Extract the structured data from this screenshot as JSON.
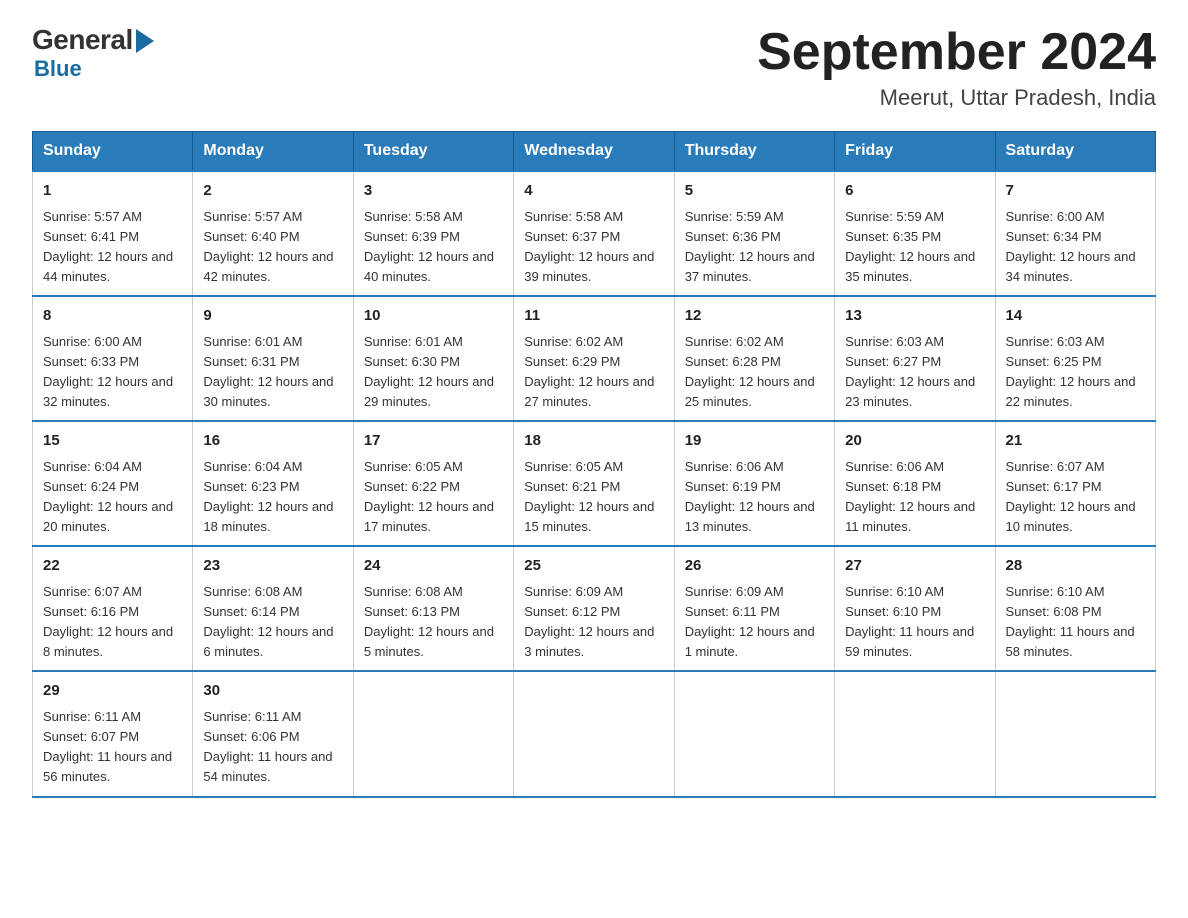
{
  "logo": {
    "general": "General",
    "blue": "Blue"
  },
  "title": {
    "month": "September 2024",
    "location": "Meerut, Uttar Pradesh, India"
  },
  "headers": [
    "Sunday",
    "Monday",
    "Tuesday",
    "Wednesday",
    "Thursday",
    "Friday",
    "Saturday"
  ],
  "weeks": [
    [
      {
        "day": "1",
        "sunrise": "5:57 AM",
        "sunset": "6:41 PM",
        "daylight": "12 hours and 44 minutes."
      },
      {
        "day": "2",
        "sunrise": "5:57 AM",
        "sunset": "6:40 PM",
        "daylight": "12 hours and 42 minutes."
      },
      {
        "day": "3",
        "sunrise": "5:58 AM",
        "sunset": "6:39 PM",
        "daylight": "12 hours and 40 minutes."
      },
      {
        "day": "4",
        "sunrise": "5:58 AM",
        "sunset": "6:37 PM",
        "daylight": "12 hours and 39 minutes."
      },
      {
        "day": "5",
        "sunrise": "5:59 AM",
        "sunset": "6:36 PM",
        "daylight": "12 hours and 37 minutes."
      },
      {
        "day": "6",
        "sunrise": "5:59 AM",
        "sunset": "6:35 PM",
        "daylight": "12 hours and 35 minutes."
      },
      {
        "day": "7",
        "sunrise": "6:00 AM",
        "sunset": "6:34 PM",
        "daylight": "12 hours and 34 minutes."
      }
    ],
    [
      {
        "day": "8",
        "sunrise": "6:00 AM",
        "sunset": "6:33 PM",
        "daylight": "12 hours and 32 minutes."
      },
      {
        "day": "9",
        "sunrise": "6:01 AM",
        "sunset": "6:31 PM",
        "daylight": "12 hours and 30 minutes."
      },
      {
        "day": "10",
        "sunrise": "6:01 AM",
        "sunset": "6:30 PM",
        "daylight": "12 hours and 29 minutes."
      },
      {
        "day": "11",
        "sunrise": "6:02 AM",
        "sunset": "6:29 PM",
        "daylight": "12 hours and 27 minutes."
      },
      {
        "day": "12",
        "sunrise": "6:02 AM",
        "sunset": "6:28 PM",
        "daylight": "12 hours and 25 minutes."
      },
      {
        "day": "13",
        "sunrise": "6:03 AM",
        "sunset": "6:27 PM",
        "daylight": "12 hours and 23 minutes."
      },
      {
        "day": "14",
        "sunrise": "6:03 AM",
        "sunset": "6:25 PM",
        "daylight": "12 hours and 22 minutes."
      }
    ],
    [
      {
        "day": "15",
        "sunrise": "6:04 AM",
        "sunset": "6:24 PM",
        "daylight": "12 hours and 20 minutes."
      },
      {
        "day": "16",
        "sunrise": "6:04 AM",
        "sunset": "6:23 PM",
        "daylight": "12 hours and 18 minutes."
      },
      {
        "day": "17",
        "sunrise": "6:05 AM",
        "sunset": "6:22 PM",
        "daylight": "12 hours and 17 minutes."
      },
      {
        "day": "18",
        "sunrise": "6:05 AM",
        "sunset": "6:21 PM",
        "daylight": "12 hours and 15 minutes."
      },
      {
        "day": "19",
        "sunrise": "6:06 AM",
        "sunset": "6:19 PM",
        "daylight": "12 hours and 13 minutes."
      },
      {
        "day": "20",
        "sunrise": "6:06 AM",
        "sunset": "6:18 PM",
        "daylight": "12 hours and 11 minutes."
      },
      {
        "day": "21",
        "sunrise": "6:07 AM",
        "sunset": "6:17 PM",
        "daylight": "12 hours and 10 minutes."
      }
    ],
    [
      {
        "day": "22",
        "sunrise": "6:07 AM",
        "sunset": "6:16 PM",
        "daylight": "12 hours and 8 minutes."
      },
      {
        "day": "23",
        "sunrise": "6:08 AM",
        "sunset": "6:14 PM",
        "daylight": "12 hours and 6 minutes."
      },
      {
        "day": "24",
        "sunrise": "6:08 AM",
        "sunset": "6:13 PM",
        "daylight": "12 hours and 5 minutes."
      },
      {
        "day": "25",
        "sunrise": "6:09 AM",
        "sunset": "6:12 PM",
        "daylight": "12 hours and 3 minutes."
      },
      {
        "day": "26",
        "sunrise": "6:09 AM",
        "sunset": "6:11 PM",
        "daylight": "12 hours and 1 minute."
      },
      {
        "day": "27",
        "sunrise": "6:10 AM",
        "sunset": "6:10 PM",
        "daylight": "11 hours and 59 minutes."
      },
      {
        "day": "28",
        "sunrise": "6:10 AM",
        "sunset": "6:08 PM",
        "daylight": "11 hours and 58 minutes."
      }
    ],
    [
      {
        "day": "29",
        "sunrise": "6:11 AM",
        "sunset": "6:07 PM",
        "daylight": "11 hours and 56 minutes."
      },
      {
        "day": "30",
        "sunrise": "6:11 AM",
        "sunset": "6:06 PM",
        "daylight": "11 hours and 54 minutes."
      },
      null,
      null,
      null,
      null,
      null
    ]
  ],
  "labels": {
    "sunrise": "Sunrise:",
    "sunset": "Sunset:",
    "daylight": "Daylight:"
  }
}
